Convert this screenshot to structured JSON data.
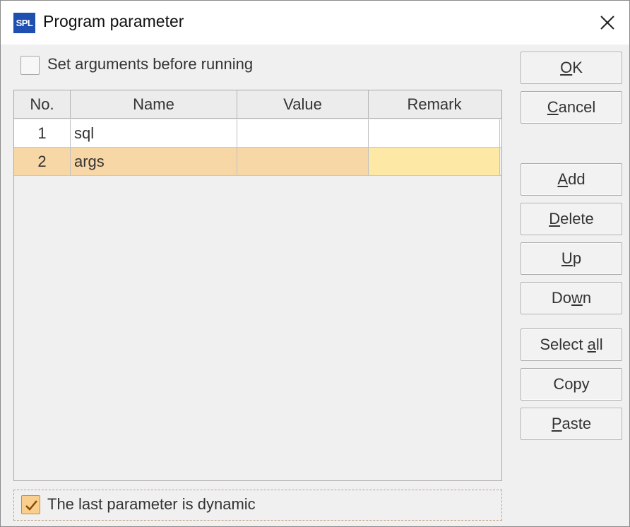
{
  "window": {
    "title": "Program parameter",
    "app_icon_text": "SPL"
  },
  "options": {
    "set_arguments_label": "Set arguments before running",
    "set_arguments_checked": false,
    "dynamic_label": "The last parameter is dynamic",
    "dynamic_checked": true
  },
  "table": {
    "headers": [
      "No.",
      "Name",
      "Value",
      "Remark"
    ],
    "rows": [
      {
        "no": "1",
        "name": "sql",
        "value": "",
        "remark": ""
      },
      {
        "no": "2",
        "name": "args",
        "value": "",
        "remark": ""
      }
    ],
    "selected_row": 2
  },
  "buttons": {
    "ok": {
      "pre": "",
      "mn": "O",
      "post": "K"
    },
    "cancel": {
      "pre": "",
      "mn": "C",
      "post": "ancel"
    },
    "add": {
      "pre": "",
      "mn": "A",
      "post": "dd"
    },
    "delete": {
      "pre": "",
      "mn": "D",
      "post": "elete"
    },
    "up": {
      "pre": "",
      "mn": "U",
      "post": "p"
    },
    "down": {
      "pre": "Do",
      "mn": "w",
      "post": "n"
    },
    "select_all": {
      "pre": "Select ",
      "mn": "a",
      "post": "ll"
    },
    "copy": {
      "pre": "Copy",
      "mn": "",
      "post": ""
    },
    "paste": {
      "pre": "",
      "mn": "P",
      "post": "aste"
    }
  },
  "colors": {
    "selected_row": "#f8d7a7",
    "selected_remark": "#fde9a5",
    "icon_bg": "#1f4fb0"
  }
}
